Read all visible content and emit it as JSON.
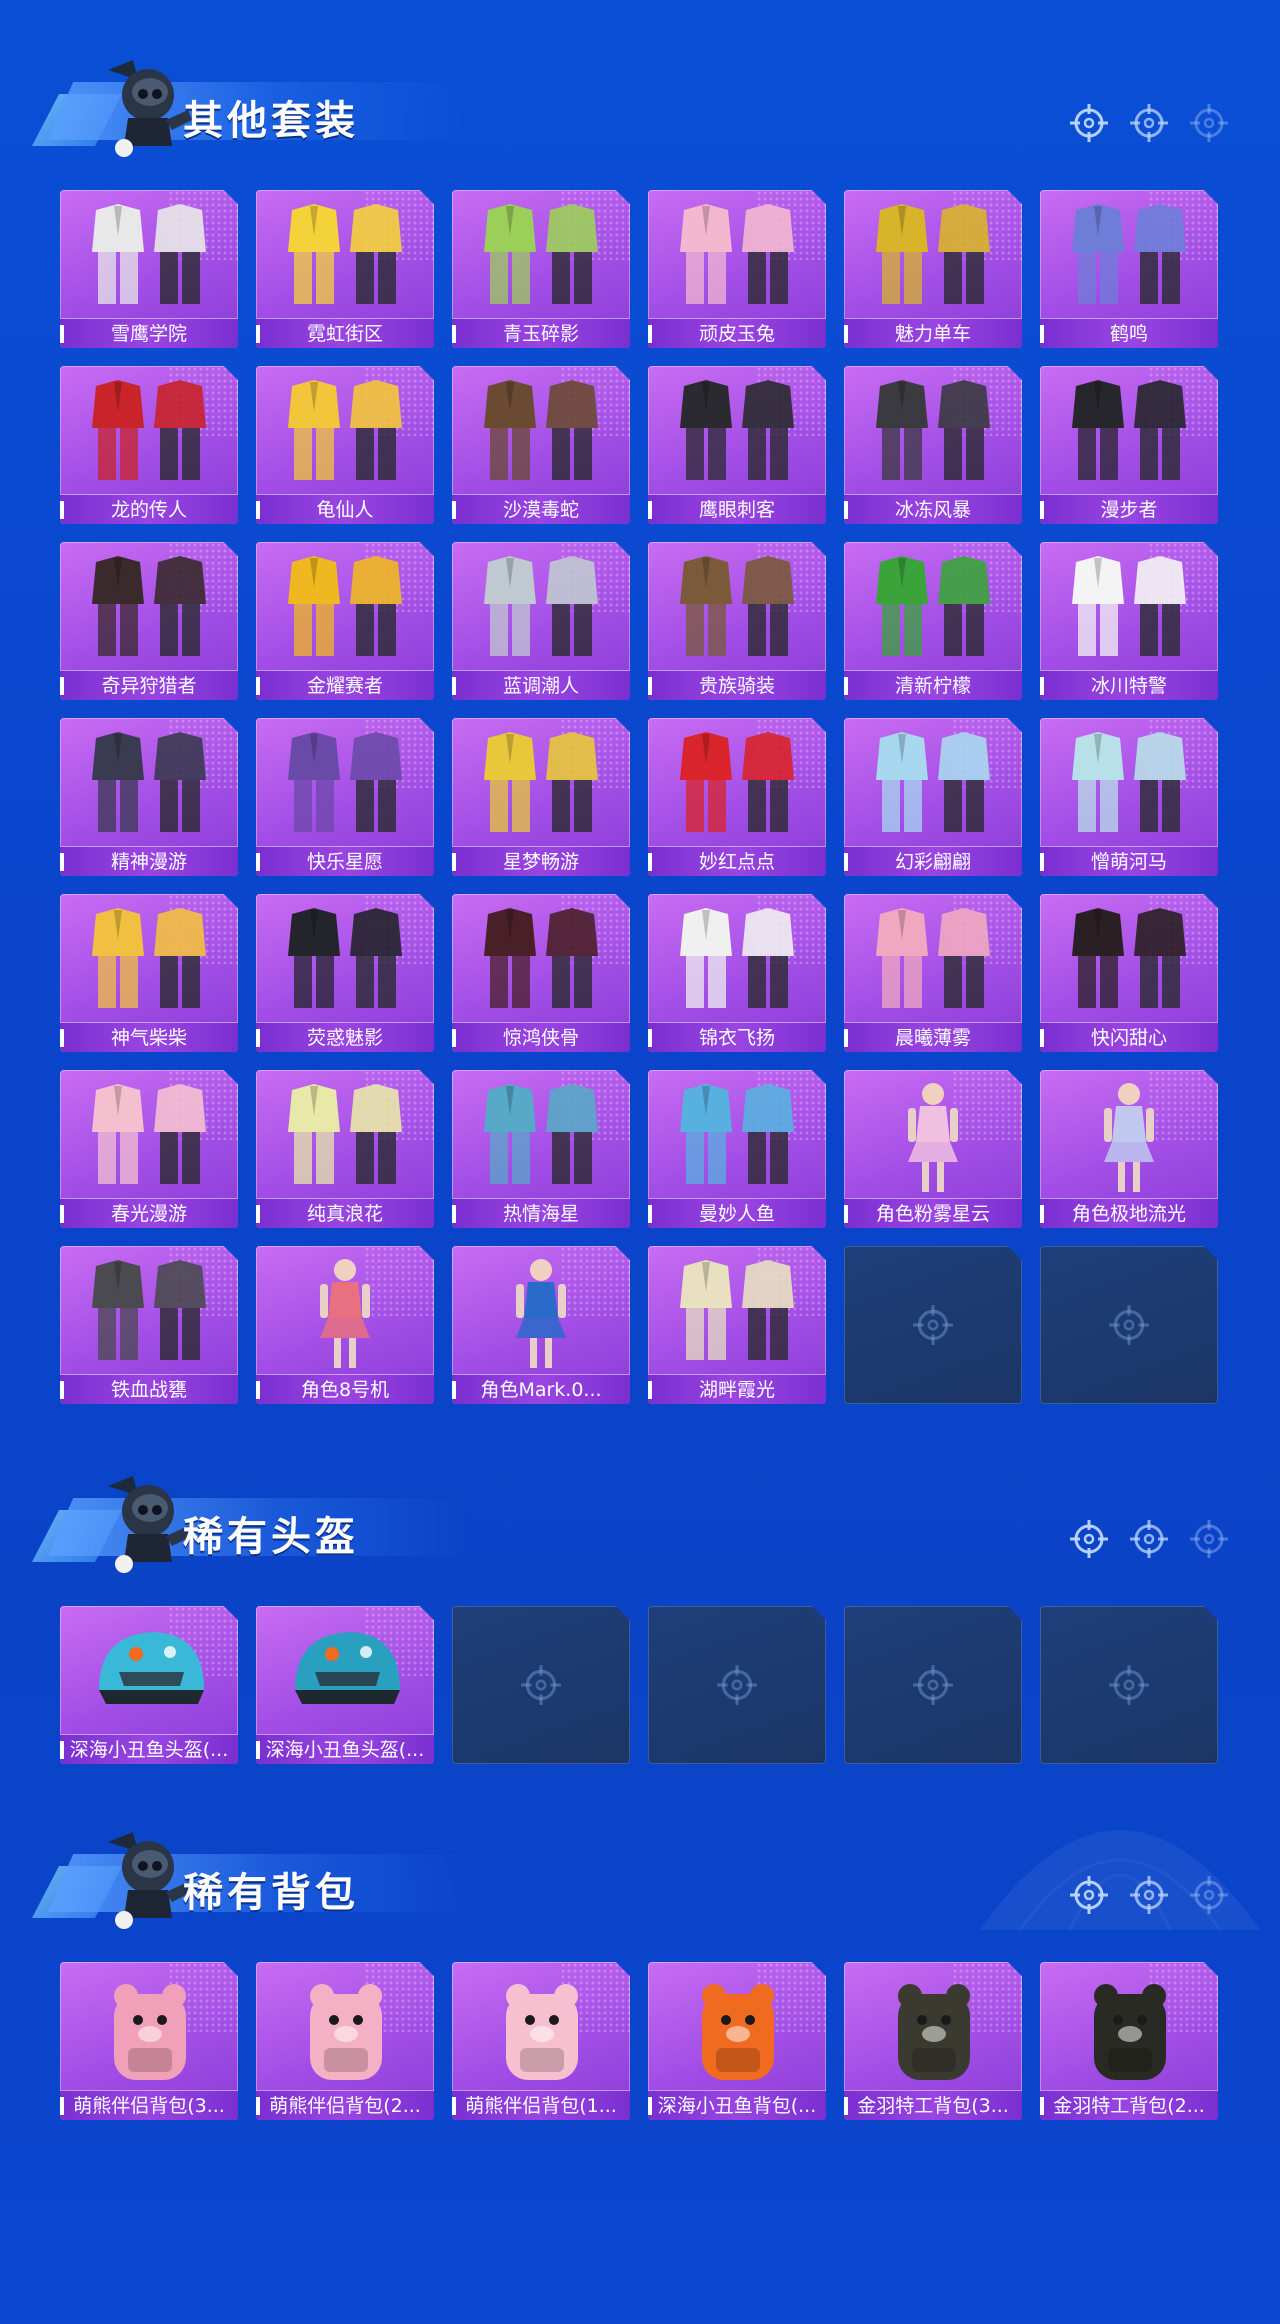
{
  "colors": {
    "background": "#0a4fd6",
    "card_purple": "#a24ee6",
    "label_bar": "#7a2fd0",
    "empty_slot": "#1f3f7a"
  },
  "sections": [
    {
      "title": "其他套装",
      "items": [
        {
          "name": "雪鹰学院",
          "icon": "outfit-icon",
          "tint": "#e8e8e8"
        },
        {
          "name": "霓虹街区",
          "icon": "outfit-icon",
          "tint": "#f4d23a"
        },
        {
          "name": "青玉碎影",
          "icon": "outfit-icon",
          "tint": "#9ccf5a"
        },
        {
          "name": "顽皮玉兔",
          "icon": "outfit-icon",
          "tint": "#f3b8d0"
        },
        {
          "name": "魅力单车",
          "icon": "outfit-icon",
          "tint": "#d8b42a"
        },
        {
          "name": "鹤鸣",
          "icon": "outfit-icon",
          "tint": "#6e7ed8"
        },
        {
          "name": "龙的传人",
          "icon": "outfit-icon",
          "tint": "#c8242a"
        },
        {
          "name": "龟仙人",
          "icon": "outfit-icon",
          "tint": "#f2c63a"
        },
        {
          "name": "沙漠毒蛇",
          "icon": "outfit-icon",
          "tint": "#6a4a32"
        },
        {
          "name": "鹰眼刺客",
          "icon": "outfit-icon",
          "tint": "#2a2a30"
        },
        {
          "name": "冰冻风暴",
          "icon": "outfit-icon",
          "tint": "#3a3a40"
        },
        {
          "name": "漫步者",
          "icon": "outfit-icon",
          "tint": "#26262c"
        },
        {
          "name": "奇异狩猎者",
          "icon": "outfit-icon",
          "tint": "#3a2a2c"
        },
        {
          "name": "金耀赛者",
          "icon": "outfit-icon",
          "tint": "#f0b820"
        },
        {
          "name": "蓝调潮人",
          "icon": "outfit-icon",
          "tint": "#c0c8d0"
        },
        {
          "name": "贵族骑装",
          "icon": "outfit-icon",
          "tint": "#7a5a3a"
        },
        {
          "name": "清新柠檬",
          "icon": "outfit-icon",
          "tint": "#3aa43a"
        },
        {
          "name": "冰川特警",
          "icon": "outfit-icon",
          "tint": "#f4f4f4"
        },
        {
          "name": "精神漫游",
          "icon": "outfit-icon",
          "tint": "#3a3a50"
        },
        {
          "name": "快乐星愿",
          "icon": "outfit-icon",
          "tint": "#6a4aa8"
        },
        {
          "name": "星梦畅游",
          "icon": "outfit-icon",
          "tint": "#e8c83a"
        },
        {
          "name": "妙红点点",
          "icon": "outfit-icon",
          "tint": "#d8242a"
        },
        {
          "name": "幻彩翩翩",
          "icon": "outfit-icon",
          "tint": "#a8d8f0"
        },
        {
          "name": "憎萌河马",
          "icon": "outfit-icon",
          "tint": "#b8e0e8"
        },
        {
          "name": "神气柴柴",
          "icon": "outfit-icon",
          "tint": "#f2c040"
        },
        {
          "name": "荧惑魅影",
          "icon": "outfit-icon",
          "tint": "#24242c"
        },
        {
          "name": "惊鸿侠骨",
          "icon": "outfit-icon",
          "tint": "#4a2028"
        },
        {
          "name": "锦衣飞扬",
          "icon": "outfit-icon",
          "tint": "#f0f0f0"
        },
        {
          "name": "晨曦薄雾",
          "icon": "outfit-icon",
          "tint": "#f0a8c0"
        },
        {
          "name": "快闪甜心",
          "icon": "outfit-icon",
          "tint": "#2a2024"
        },
        {
          "name": "春光漫游",
          "icon": "outfit-icon",
          "tint": "#f4c0d0"
        },
        {
          "name": "纯真浪花",
          "icon": "outfit-icon",
          "tint": "#e8e8a8"
        },
        {
          "name": "热情海星",
          "icon": "outfit-icon",
          "tint": "#58a8c8"
        },
        {
          "name": "曼妙人鱼",
          "icon": "outfit-icon",
          "tint": "#58b0e0"
        },
        {
          "name": "角色粉雾星云",
          "icon": "character-icon",
          "tint": "#f0c0e0"
        },
        {
          "name": "角色极地流光",
          "icon": "character-icon",
          "tint": "#c0c8f0"
        },
        {
          "name": "铁血战甕",
          "icon": "outfit-icon",
          "tint": "#4a4a50"
        },
        {
          "name": "角色8号机",
          "icon": "character-icon",
          "tint": "#e87080"
        },
        {
          "name": "角色Mark.0...",
          "icon": "character-icon",
          "tint": "#2a6ac8"
        },
        {
          "name": "湖畔霞光",
          "icon": "outfit-icon",
          "tint": "#e8e0c0"
        }
      ],
      "empty_slots": 2
    },
    {
      "title": "稀有头盔",
      "items": [
        {
          "name": "深海小丑鱼头盔(...",
          "icon": "helmet-icon",
          "tint": "#3ab8d8"
        },
        {
          "name": "深海小丑鱼头盔(...",
          "icon": "helmet-icon",
          "tint": "#2aa0c0"
        }
      ],
      "empty_slots": 4
    },
    {
      "title": "稀有背包",
      "items": [
        {
          "name": "萌熊伴侣背包(3...",
          "icon": "backpack-icon",
          "tint": "#f0a0b8"
        },
        {
          "name": "萌熊伴侣背包(2...",
          "icon": "backpack-icon",
          "tint": "#f4b0c4"
        },
        {
          "name": "萌熊伴侣背包(1...",
          "icon": "backpack-icon",
          "tint": "#f6c0d0"
        },
        {
          "name": "深海小丑鱼背包(...",
          "icon": "backpack-icon",
          "tint": "#f06a20"
        },
        {
          "name": "金羽特工背包(3...",
          "icon": "backpack-icon",
          "tint": "#3a3a30"
        },
        {
          "name": "金羽特工背包(2...",
          "icon": "backpack-icon",
          "tint": "#2a2a24"
        }
      ],
      "empty_slots": 0
    }
  ]
}
